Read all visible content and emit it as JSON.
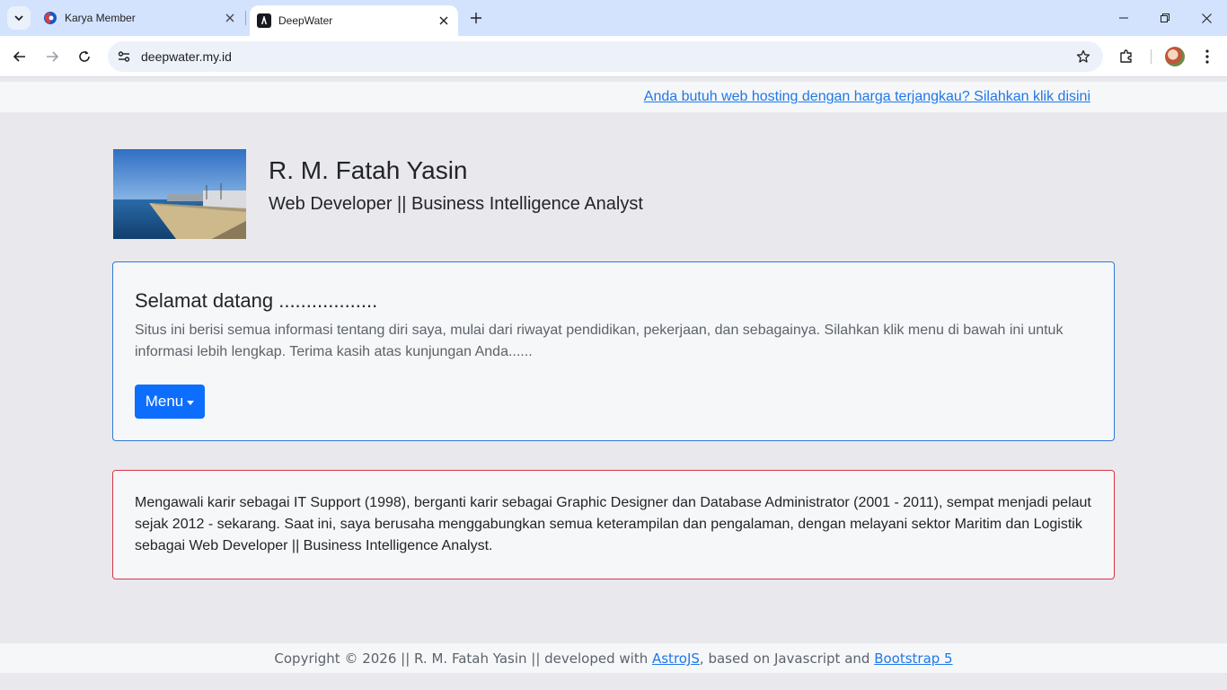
{
  "browser": {
    "tabs": [
      {
        "title": "Karya Member",
        "active": false
      },
      {
        "title": "DeepWater",
        "active": true
      }
    ],
    "url": "deepwater.my.id"
  },
  "page": {
    "promo_link": "Anda butuh web hosting dengan harga terjangkau? Silahkan klik disini",
    "profile": {
      "name": "R. M. Fatah Yasin",
      "role": "Web Developer || Business Intelligence Analyst"
    },
    "welcome": {
      "title": "Selamat datang ..................",
      "text": "Situs ini berisi semua informasi tentang diri saya, mulai dari riwayat pendidikan, pekerjaan, dan sebagainya. Silahkan klik menu di bawah ini untuk informasi lebih lengkap. Terima kasih atas kunjungan Anda......",
      "menu_label": "Menu"
    },
    "career": {
      "text": "Mengawali karir sebagai IT Support (1998), berganti karir sebagai Graphic Designer dan Database Administrator (2001 - 2011), sempat menjadi pelaut sejak 2012 - sekarang. Saat ini, saya berusaha menggabungkan semua keterampilan dan pengalaman, dengan melayani sektor Maritim dan Logistik sebagai Web Developer || Business Intelligence Analyst."
    },
    "footer": {
      "prefix": "Copyright © 2026 || R. M. Fatah Yasin || developed with ",
      "link1": "AstroJS",
      "middle": ", based on Javascript and ",
      "link2": "Bootstrap 5"
    }
  },
  "colors": {
    "primary": "#0d6efd",
    "welcome_border": "#2f7bd6",
    "career_border": "#dc3545",
    "link": "#1f78e8"
  }
}
